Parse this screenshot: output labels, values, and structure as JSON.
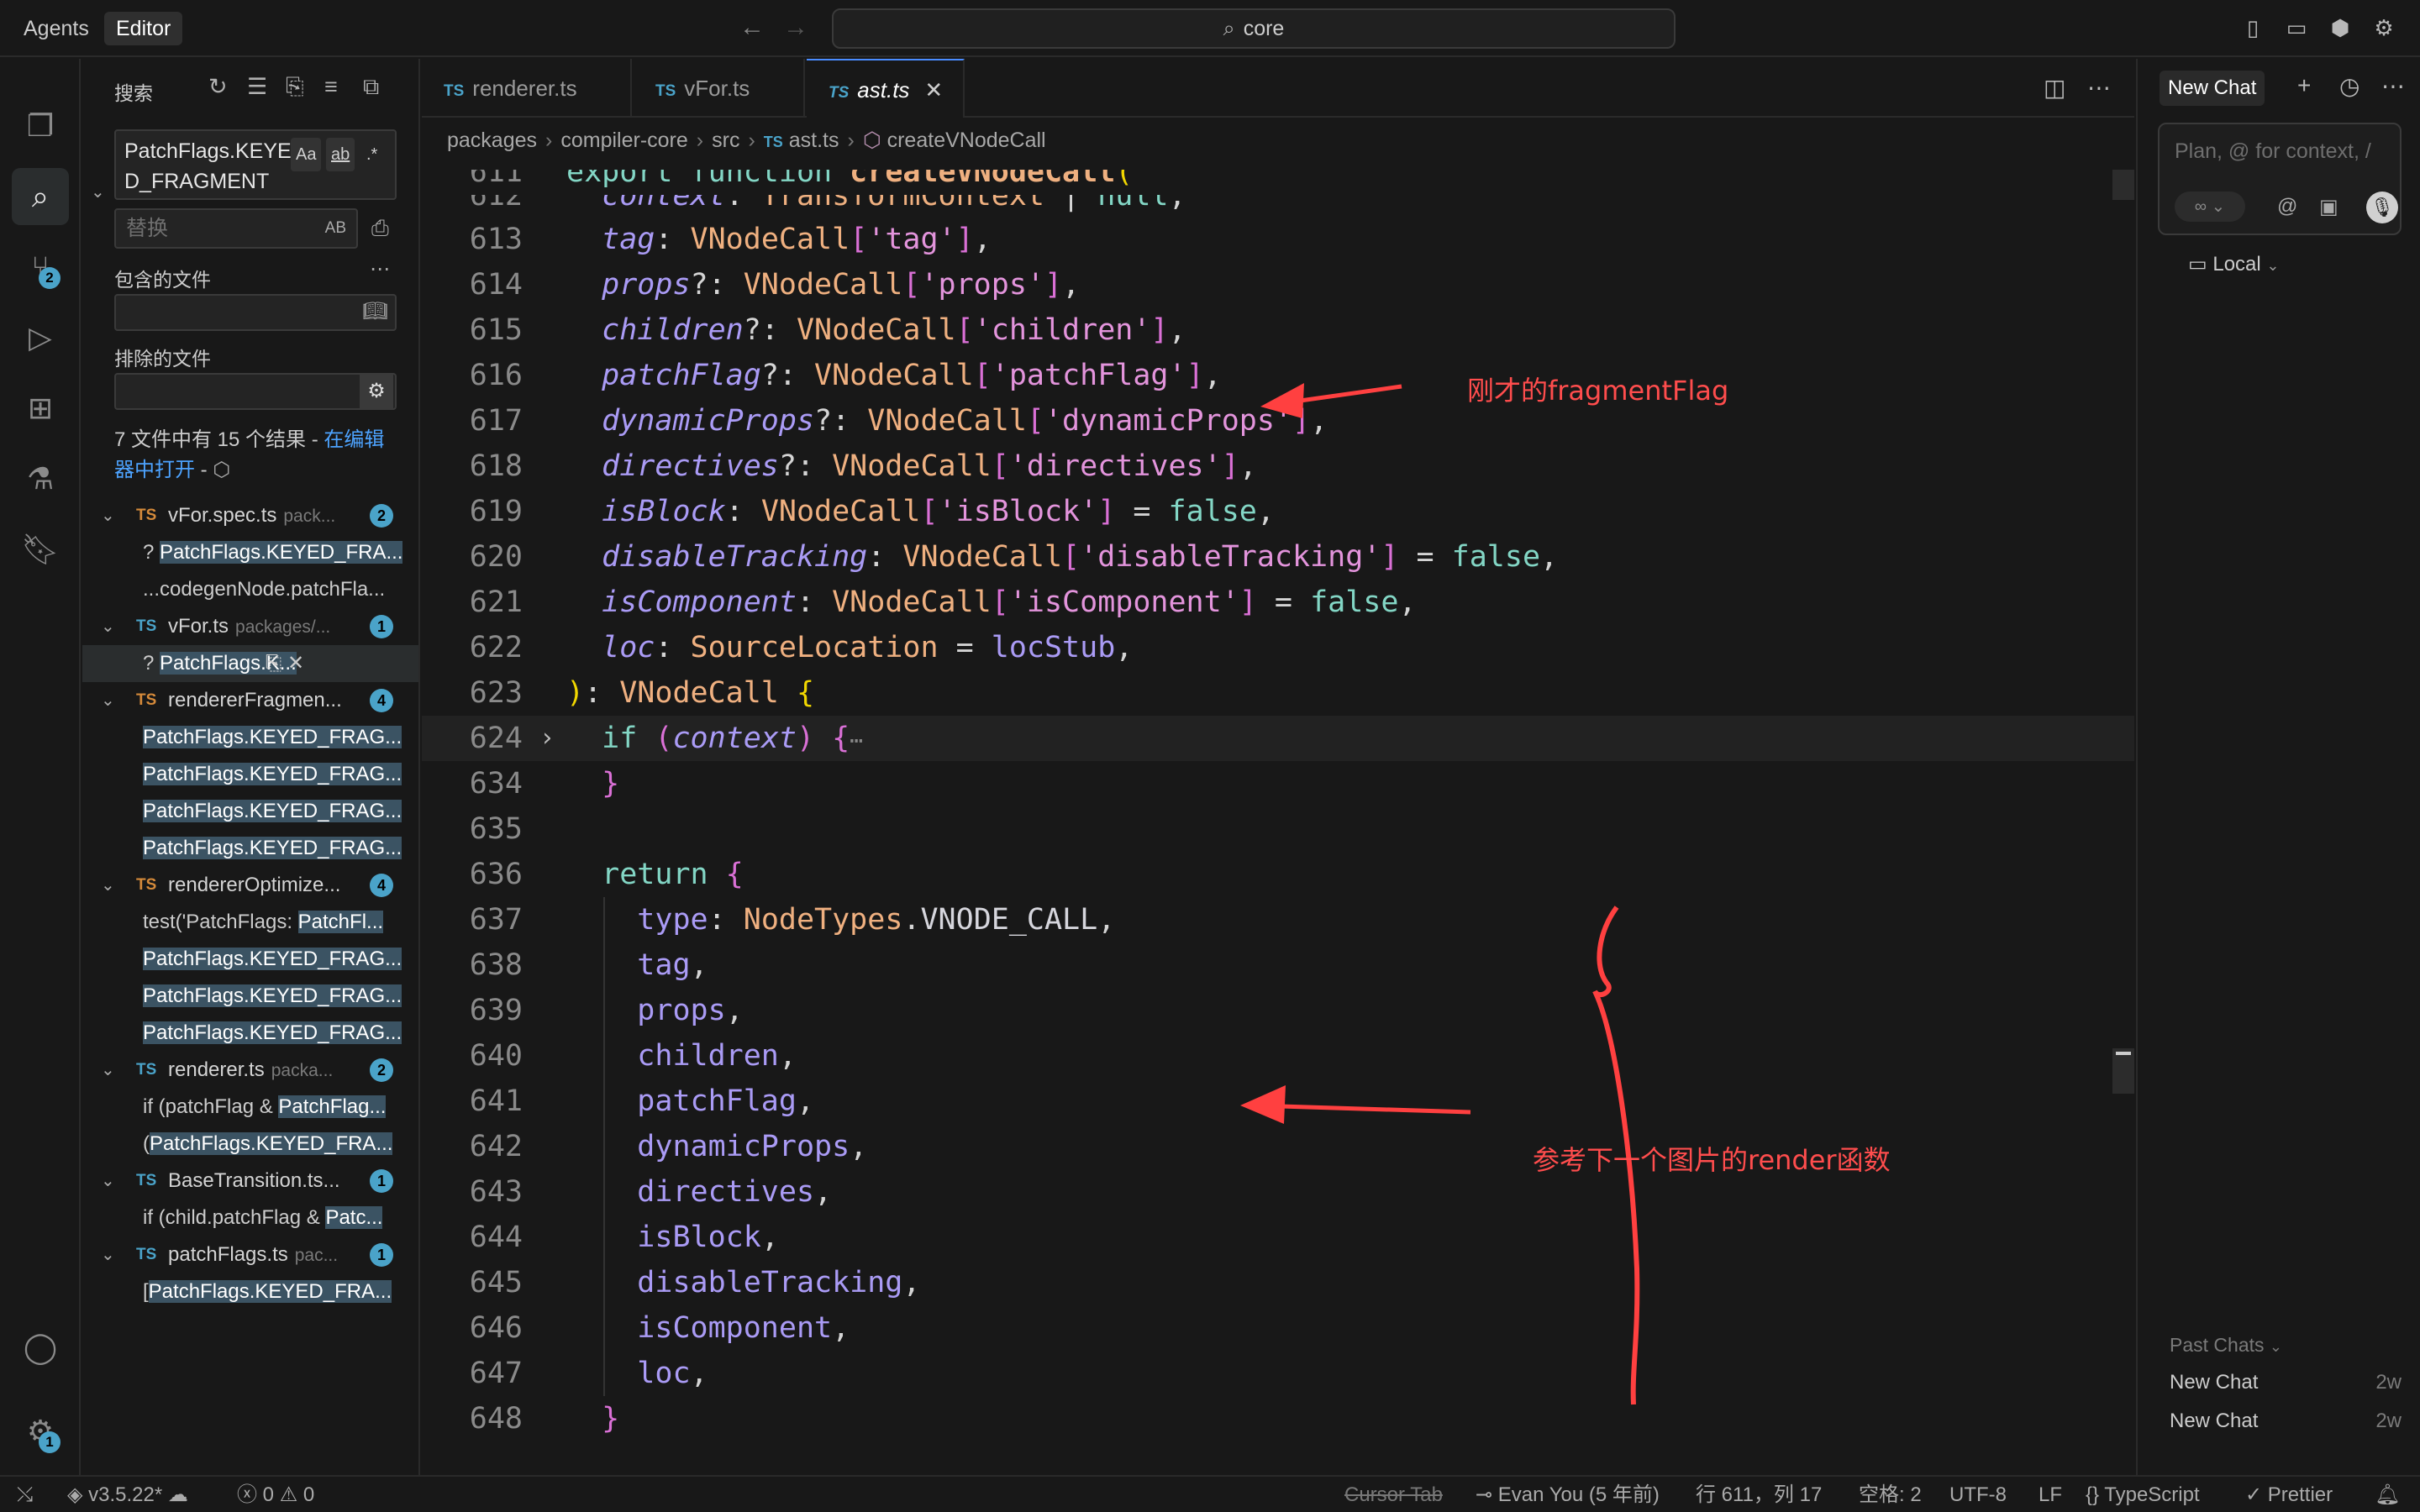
{
  "titlebar": {
    "modes": [
      "Agents",
      "Editor"
    ],
    "search": "core"
  },
  "activity": {
    "scm_badge": "2",
    "settings_badge": "1"
  },
  "sidebar": {
    "title": "搜索",
    "find_value": "PatchFlags.KEYED_FRAGMENT",
    "opt_case": "Aa",
    "opt_word": "ab",
    "opt_regex": ".*",
    "replace_placeholder": "替换",
    "replace_opt": "AB",
    "include_label": "包含的文件",
    "exclude_label": "排除的文件",
    "summary_text": "7 文件中有 15 个结果 - ",
    "summary_link": "在编辑器中打开",
    "summary_tail": " - ",
    "results": [
      {
        "file": "vFor.spec.ts",
        "path": "pack...",
        "count": "2",
        "ts_color": "orange",
        "matches": [
          {
            "pre": "? ",
            "hl": "PatchFlags.KEYED_FRA...",
            "post": ""
          },
          {
            "pre": "...codegenNode.patchFla...",
            "hl": "",
            "post": ""
          }
        ]
      },
      {
        "file": "vFor.ts",
        "path": "packages/...",
        "count": "1",
        "ts_color": "blue",
        "matches": [
          {
            "pre": "? ",
            "hl": "PatchFlags.K...",
            "post": "",
            "selected": true
          }
        ]
      },
      {
        "file": "rendererFragmen...",
        "path": "",
        "count": "4",
        "ts_color": "orange",
        "matches": [
          {
            "pre": "",
            "hl": "PatchFlags.KEYED_FRAG...",
            "post": ""
          },
          {
            "pre": "",
            "hl": "PatchFlags.KEYED_FRAG...",
            "post": ""
          },
          {
            "pre": "",
            "hl": "PatchFlags.KEYED_FRAG...",
            "post": ""
          },
          {
            "pre": "",
            "hl": "PatchFlags.KEYED_FRAG...",
            "post": ""
          }
        ]
      },
      {
        "file": "rendererOptimize...",
        "path": "",
        "count": "4",
        "ts_color": "orange",
        "matches": [
          {
            "pre": "test('PatchFlags: ",
            "hl": "PatchFl...",
            "post": ""
          },
          {
            "pre": "",
            "hl": "PatchFlags.KEYED_FRAG...",
            "post": ""
          },
          {
            "pre": "",
            "hl": "PatchFlags.KEYED_FRAG...",
            "post": ""
          },
          {
            "pre": "",
            "hl": "PatchFlags.KEYED_FRAG...",
            "post": ""
          }
        ]
      },
      {
        "file": "renderer.ts",
        "path": "packa...",
        "count": "2",
        "ts_color": "blue",
        "matches": [
          {
            "pre": "if (patchFlag & ",
            "hl": "PatchFlag...",
            "post": ""
          },
          {
            "pre": "(",
            "hl": "PatchFlags.KEYED_FRA...",
            "post": ""
          }
        ]
      },
      {
        "file": "BaseTransition.ts...",
        "path": "",
        "count": "1",
        "ts_color": "blue",
        "matches": [
          {
            "pre": "if (child.patchFlag & ",
            "hl": "Patc...",
            "post": ""
          }
        ]
      },
      {
        "file": "patchFlags.ts",
        "path": "pac...",
        "count": "1",
        "ts_color": "blue",
        "matches": [
          {
            "pre": "[",
            "hl": "PatchFlags.KEYED_FRA...",
            "post": ""
          }
        ]
      }
    ]
  },
  "editor": {
    "tabs": [
      {
        "label": "renderer.ts",
        "active": false
      },
      {
        "label": "vFor.ts",
        "active": false
      },
      {
        "label": "ast.ts",
        "active": true
      }
    ],
    "breadcrumbs": [
      "packages",
      "compiler-core",
      "src",
      "ast.ts",
      "createVNodeCall"
    ],
    "line_numbers": [
      "611",
      "612",
      "613",
      "614",
      "615",
      "616",
      "617",
      "618",
      "619",
      "620",
      "621",
      "622",
      "623",
      "624",
      "634",
      "635",
      "636",
      "637",
      "638",
      "639",
      "640",
      "641",
      "642",
      "643",
      "644",
      "645",
      "646",
      "647",
      "648"
    ],
    "annotation_1": "刚才的fragmentFlag",
    "annotation_2": "参考下一个图片的render函数"
  },
  "chat": {
    "tab_label": "New Chat",
    "placeholder": "Plan, @ for context, /",
    "mode_pill": "∞",
    "env_label": "Local",
    "past_label": "Past Chats",
    "items": [
      {
        "title": "New Chat",
        "when": "2w"
      },
      {
        "title": "New Chat",
        "when": "2w"
      }
    ]
  },
  "statusbar": {
    "branch": "v3.5.22*",
    "errors": "0",
    "warnings": "0",
    "cursor_tab": "Cursor Tab",
    "blame": "Evan You (5 年前)",
    "position": "行 611，列 17",
    "spaces": "空格: 2",
    "encoding": "UTF-8",
    "eol": "LF",
    "language": "TypeScript",
    "formatter": "Prettier"
  }
}
